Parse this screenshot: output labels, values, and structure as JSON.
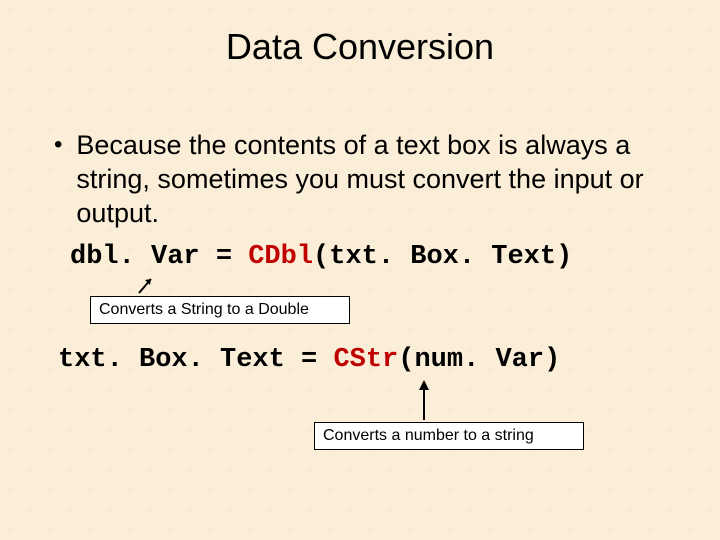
{
  "title": "Data Conversion",
  "bullet": "Because the contents of a text box is always a string, sometimes you must convert the input or output.",
  "code1": {
    "lhs": "dbl. Var = ",
    "fn": "CDbl",
    "args": "(txt. Box. Text)"
  },
  "caption1": "Converts a String to a Double",
  "code2": {
    "lhs": "txt. Box. Text = ",
    "fn": "CStr",
    "args": "(num. Var)"
  },
  "caption2": "Converts a number to a string"
}
